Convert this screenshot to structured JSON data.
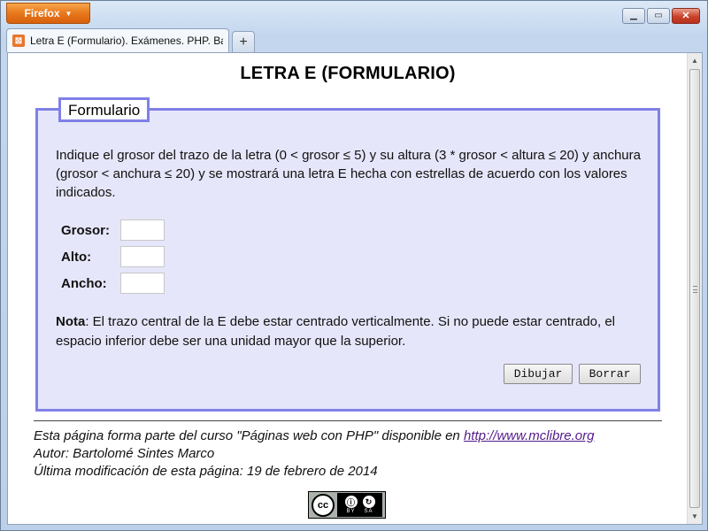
{
  "browser": {
    "menu_label": "Firefox",
    "tab_title": "Letra E (Formulario). Exámenes. PHP. Bar...",
    "new_tab_label": "+",
    "controls": {
      "minimize": "▁",
      "maximize": "▭",
      "close": "✕"
    }
  },
  "page": {
    "heading": "LETRA E (FORMULARIO)",
    "fieldset_legend": "Formulario",
    "description": "Indique el grosor del trazo de la letra (0 < grosor ≤ 5) y su altura (3 * grosor < altura ≤ 20) y anchura (grosor < anchura ≤ 20) y se mostrará una letra E hecha con estrellas de acuerdo con los valores indicados.",
    "fields": [
      {
        "label": "Grosor:",
        "value": ""
      },
      {
        "label": "Alto:",
        "value": ""
      },
      {
        "label": "Ancho:",
        "value": ""
      }
    ],
    "note_label": "Nota",
    "note_text": ": El trazo central de la E debe estar centrado verticalmente. Si no puede estar centrado, el espacio inferior debe ser una unidad mayor que la superior.",
    "buttons": {
      "draw": "Dibujar",
      "reset": "Borrar"
    },
    "footer": {
      "course_prefix": "Esta página forma parte del curso \"Páginas web con PHP\" disponible en ",
      "course_link": "http://www.mclibre.org",
      "author": "Autor: Bartolomé Sintes Marco",
      "modified": "Última modificación de esta página: 19 de febrero de 2014"
    },
    "license": {
      "cc": "cc",
      "by": "BY",
      "sa": "SA"
    }
  }
}
